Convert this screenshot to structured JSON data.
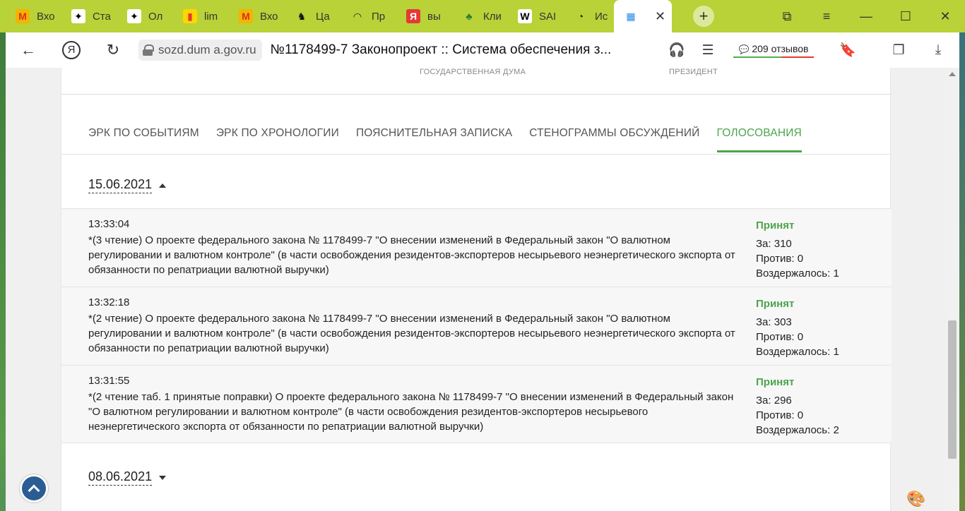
{
  "browser": {
    "tabs": [
      {
        "label": "Вхо",
        "icon": "M",
        "icon_color": "#d93025",
        "icon_bg": "#f4b400"
      },
      {
        "label": "Ста",
        "icon": "✦",
        "icon_color": "#000000",
        "icon_bg": "#ffffff"
      },
      {
        "label": "Ол",
        "icon": "✦",
        "icon_color": "#000000",
        "icon_bg": "#ffffff"
      },
      {
        "label": "lim",
        "icon": "▮",
        "icon_color": "#e53935",
        "icon_bg": "#ffd600"
      },
      {
        "label": "Вхо",
        "icon": "M",
        "icon_color": "#d93025",
        "icon_bg": "#f4b400"
      },
      {
        "label": "Ца",
        "icon": "♞",
        "icon_color": "#111111",
        "icon_bg": "transparent"
      },
      {
        "label": "Пр",
        "icon": "◠",
        "icon_color": "#222222",
        "icon_bg": "transparent"
      },
      {
        "label": "вы",
        "icon": "Я",
        "icon_color": "#ffffff",
        "icon_bg": "#e53935"
      },
      {
        "label": "Кли",
        "icon": "♣",
        "icon_color": "#2e7d32",
        "icon_bg": "transparent"
      },
      {
        "label": "SAI",
        "icon": "W",
        "icon_color": "#000000",
        "icon_bg": "#ffffff"
      },
      {
        "label": "Ис",
        "icon": "◔",
        "icon_color": "#222222",
        "icon_bg": "transparent"
      }
    ],
    "active_tab_icon": "▦",
    "close_glyph": "✕",
    "new_tab_glyph": "+",
    "window_controls": {
      "collections": "⧉",
      "menu": "≡",
      "minimize": "—",
      "maximize": "☐",
      "close": "✕"
    },
    "nav": {
      "back": "←",
      "yandex": "Я",
      "reload": "↻"
    },
    "url": "sozd.dum a.gov.ru",
    "page_title": "№1178499-7 Законопроект :: Система обеспечения з...",
    "reviews": "209 отзывов",
    "review_icon": "💬",
    "icons": {
      "headphones": "🎧",
      "reader": "☰",
      "bookmark": "🔖",
      "extensions": "❐",
      "download": "⤓"
    }
  },
  "page": {
    "stages": {
      "duma": "ГОСУДАРСТВЕННАЯ ДУМА",
      "president": "ПРЕЗИДЕНТ"
    },
    "tabs": [
      {
        "label": "ЭРК ПО СОБЫТИЯМ",
        "active": false
      },
      {
        "label": "ЭРК ПО ХРОНОЛОГИИ",
        "active": false
      },
      {
        "label": "ПОЯСНИТЕЛЬНАЯ ЗАПИСКА",
        "active": false
      },
      {
        "label": "СТЕНОГРАММЫ ОБСУЖДЕНИЙ",
        "active": false
      },
      {
        "label": "ГОЛОСОВАНИЯ",
        "active": true
      }
    ],
    "date_groups": [
      {
        "date": "15.06.2021",
        "expanded": true,
        "votes": [
          {
            "time": "13:33:04",
            "description": "*(3 чтение) О проекте федерального закона № 1178499-7 \"О внесении изменений в Федеральный закон \"О валютном регулировании и валютном контроле\" (в части освобождения резидентов-экспортеров несырьевого неэнергетического экспорта от обязанности по репатриации валютной выручки)",
            "status": "Принят",
            "for": "За: 310",
            "against": "Против: 0",
            "abstained": "Воздержалось: 1"
          },
          {
            "time": "13:32:18",
            "description": "*(2 чтение) О проекте федерального закона № 1178499-7 \"О внесении изменений в Федеральный закон \"О валютном регулировании и валютном контроле\" (в части освобождения резидентов-экспортеров несырьевого неэнергетического экспорта от обязанности по репатриации валютной выручки)",
            "status": "Принят",
            "for": "За: 303",
            "against": "Против: 0",
            "abstained": "Воздержалось: 1"
          },
          {
            "time": "13:31:55",
            "description": "*(2 чтение таб. 1 принятые поправки) О проекте федерального закона № 1178499-7 \"О внесении изменений в Федеральный закон \"О валютном регулировании и валютном контроле\" (в части освобождения резидентов-экспортеров несырьевого неэнергетического экспорта от обязанности по репатриации валютной выручки)",
            "status": "Принят",
            "for": "За: 296",
            "against": "Против: 0",
            "abstained": "Воздержалось: 2"
          }
        ]
      },
      {
        "date": "08.06.2021",
        "expanded": false,
        "votes": []
      }
    ],
    "palette_icon": "🎨"
  }
}
